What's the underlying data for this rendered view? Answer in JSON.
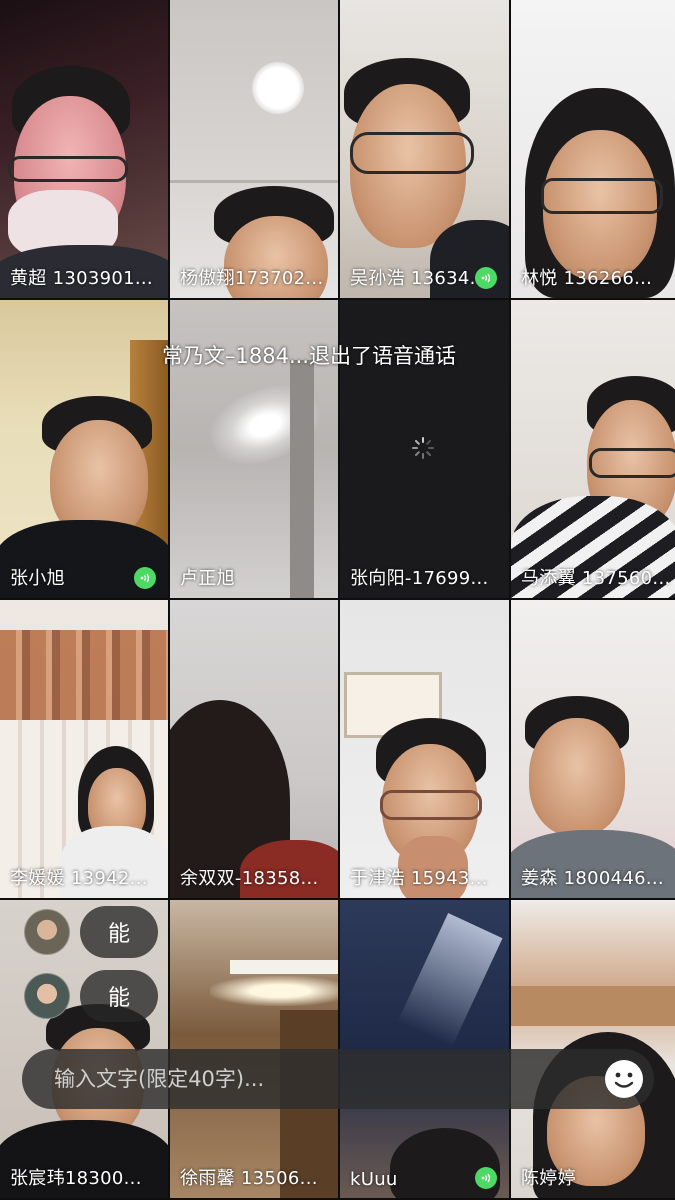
{
  "participants": [
    {
      "name": "黄超  1303901...",
      "speaking": false
    },
    {
      "name": "杨傲翔173702...",
      "speaking": false
    },
    {
      "name": "吴孙浩 13634...",
      "speaking": true
    },
    {
      "name": "林悦  136266...",
      "speaking": false
    },
    {
      "name": "张小旭",
      "speaking": true
    },
    {
      "name": "卢正旭",
      "speaking": false
    },
    {
      "name": "张向阳-17699...",
      "speaking": false
    },
    {
      "name": "马添翼 137560...",
      "speaking": false
    },
    {
      "name": "李媛媛 13942...",
      "speaking": false
    },
    {
      "name": "余双双-18358...",
      "speaking": false
    },
    {
      "name": "于津浩 15943...",
      "speaking": false
    },
    {
      "name": "姜森 1800446...",
      "speaking": false
    },
    {
      "name": "张宸玮18300...",
      "speaking": false
    },
    {
      "name": "徐雨馨 13506...",
      "speaking": false
    },
    {
      "name": "kUuu",
      "speaking": true
    },
    {
      "name": "陈婷婷",
      "speaking": false
    }
  ],
  "notice": "常乃文–1884...退出了语音通话",
  "chat_messages": [
    {
      "text": "能"
    },
    {
      "text": "能"
    }
  ],
  "input": {
    "placeholder": "输入文字(限定40字)..."
  },
  "icons": {
    "speaking": "mic-active-icon",
    "loading": "loading-spinner-icon",
    "emoji": "emoji-icon"
  },
  "colors": {
    "speaking_badge": "#4cd964"
  }
}
